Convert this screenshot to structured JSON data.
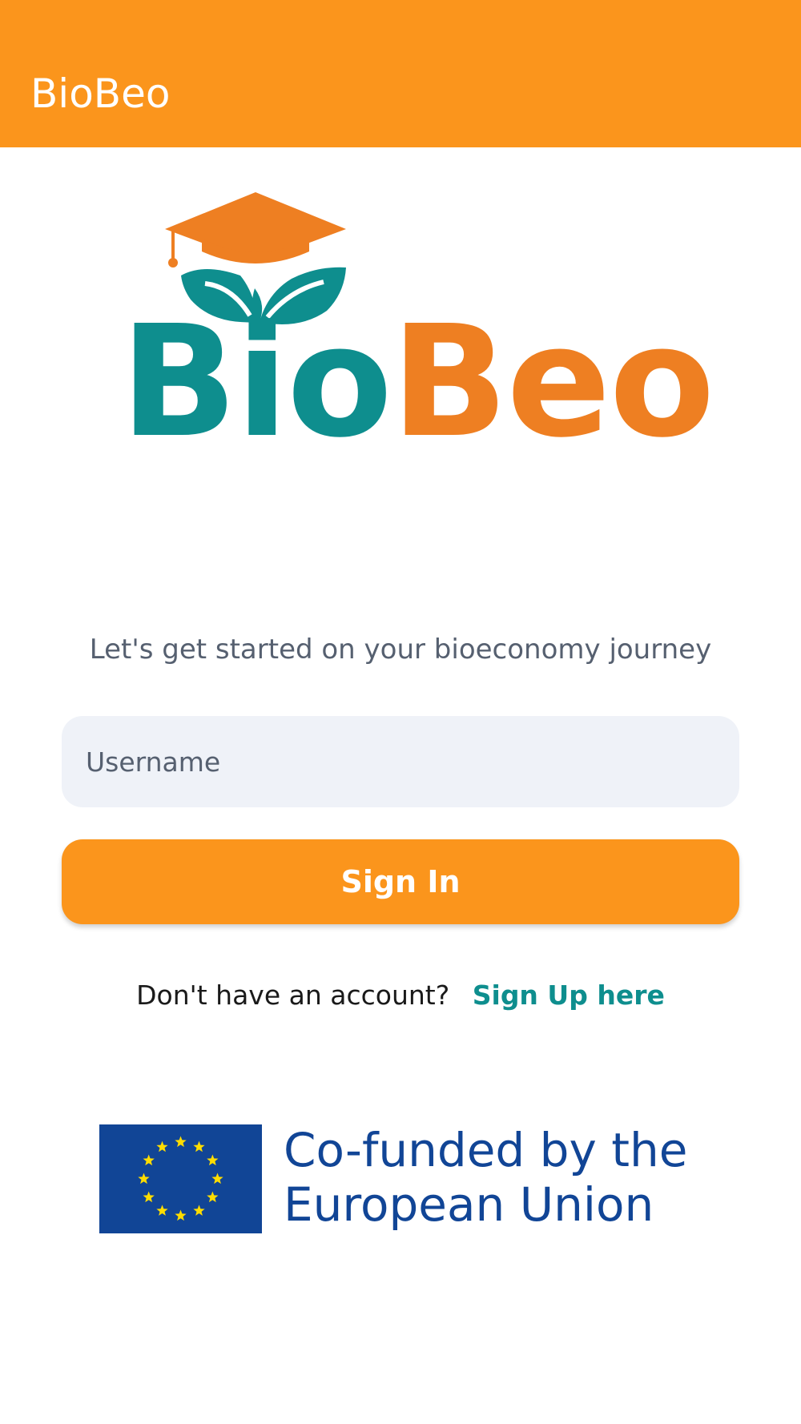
{
  "app_bar": {
    "title": "BioBeo",
    "color": "#FB951C"
  },
  "logo": {
    "name": "BioBeo logo",
    "text_part_1": "Bio",
    "text_part_2": "Beo",
    "colors": {
      "teal": "#0E8E8E",
      "orange": "#EE7F22"
    }
  },
  "login": {
    "tagline": "Let's get started on your bioeconomy journey",
    "username_placeholder": "Username",
    "username_value": "",
    "sign_in_label": "Sign In",
    "signup_prompt": "Don't have an account?",
    "signup_link": "Sign Up here"
  },
  "footer": {
    "eu_line_1": "Co-funded by the",
    "eu_line_2": "European Union",
    "eu_flag_icon": "eu-flag-icon",
    "eu_blue": "#114596",
    "eu_star_yellow": "#FFDD00"
  }
}
